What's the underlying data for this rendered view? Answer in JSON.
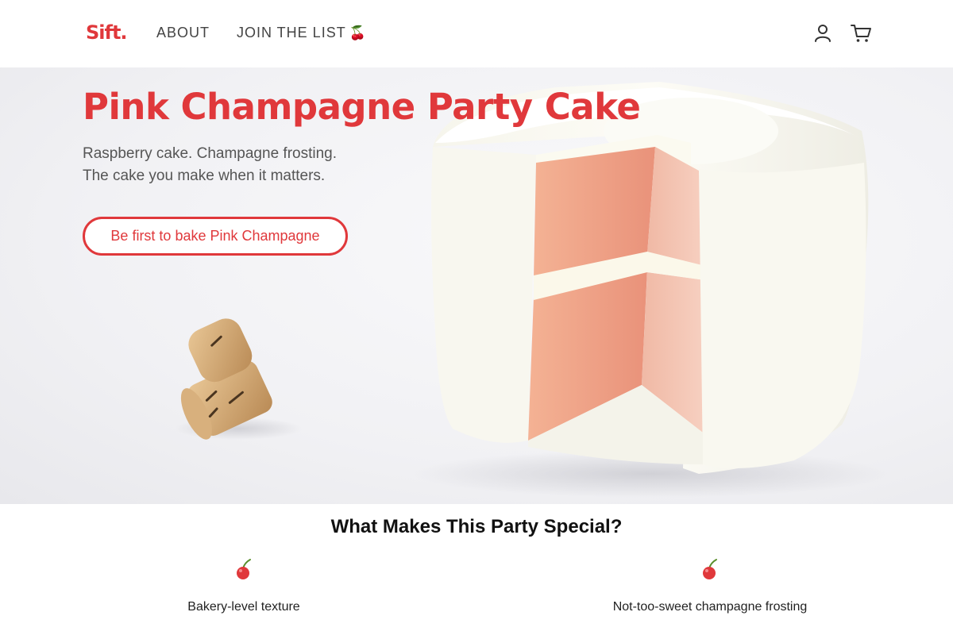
{
  "nav": {
    "logo": "Sift.",
    "links": [
      {
        "label": "ABOUT"
      },
      {
        "label": "JOIN THE LIST",
        "emoji": "🍒"
      }
    ],
    "icons": [
      "account-icon",
      "cart-icon"
    ]
  },
  "hero": {
    "title": "Pink Champagne Party Cake",
    "subtitle_line1": "Raspberry cake. Champagne frosting.",
    "subtitle_line2": "The cake you make when it matters.",
    "cta_label": "Be first to bake Pink Champagne",
    "image": "pink-champagne-cake-photo",
    "prop": "champagne-cork"
  },
  "features": {
    "title": "What Makes This Party Special?",
    "items": [
      {
        "icon": "cherry-icon",
        "label": "Bakery-level texture"
      },
      {
        "icon": "cherry-icon",
        "label": "Not-too-sweet champagne frosting"
      }
    ]
  },
  "colors": {
    "brand": "#e0383b",
    "text": "#555555",
    "frosting": "#fbfaf2",
    "sponge": "#f4a88c"
  }
}
